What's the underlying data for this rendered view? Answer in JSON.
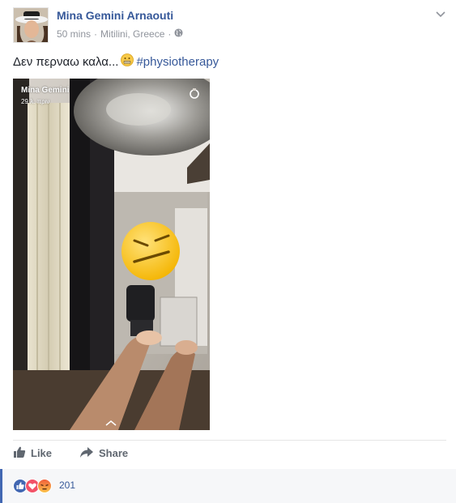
{
  "post": {
    "author": "Mina Gemini Arnaouti",
    "time": "50 mins",
    "separator": "·",
    "location": "Mitilini, Greece",
    "privacy_icon": "globe-icon",
    "text": "Δεν περναω καλα...",
    "hashtag": "#physiotherapy",
    "emoji": "grimacing-emoji"
  },
  "photo": {
    "snap_name": "Mina Gemini",
    "snap_time": "29 λ. πριν",
    "sticker": "expressionless-face-emoji"
  },
  "actions": {
    "like_label": "Like",
    "share_label": "Share"
  },
  "reactions": {
    "icons": [
      "like-icon",
      "love-icon",
      "angry-icon"
    ],
    "count": "201"
  },
  "colors": {
    "link": "#365899",
    "meta": "#90949c",
    "action": "#606770",
    "like_blue": "#4267b2",
    "love_red": "#f25268",
    "angry_orange": "#f7714b"
  }
}
